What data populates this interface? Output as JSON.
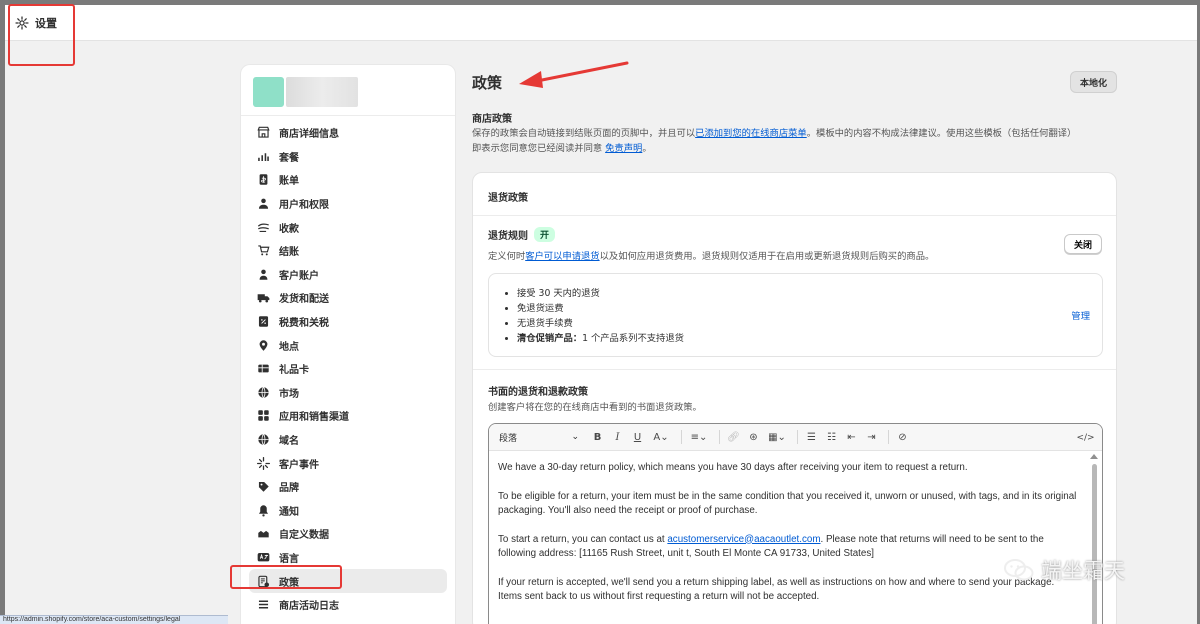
{
  "header": {
    "title": "设置"
  },
  "sidebar": {
    "items": [
      {
        "label": "商店详细信息",
        "icon": "store-icon"
      },
      {
        "label": "套餐",
        "icon": "chart-bars-icon"
      },
      {
        "label": "账单",
        "icon": "bill-icon"
      },
      {
        "label": "用户和权限",
        "icon": "user-icon"
      },
      {
        "label": "收款",
        "icon": "payment-icon"
      },
      {
        "label": "结账",
        "icon": "cart-icon"
      },
      {
        "label": "客户账户",
        "icon": "person-icon"
      },
      {
        "label": "发货和配送",
        "icon": "truck-icon"
      },
      {
        "label": "税费和关税",
        "icon": "tax-icon"
      },
      {
        "label": "地点",
        "icon": "location-icon"
      },
      {
        "label": "礼品卡",
        "icon": "gift-card-icon"
      },
      {
        "label": "市场",
        "icon": "globe-icon"
      },
      {
        "label": "应用和销售渠道",
        "icon": "apps-icon"
      },
      {
        "label": "域名",
        "icon": "globe-icon"
      },
      {
        "label": "客户事件",
        "icon": "sparkle-icon"
      },
      {
        "label": "品牌",
        "icon": "brand-icon"
      },
      {
        "label": "通知",
        "icon": "bell-icon"
      },
      {
        "label": "自定义数据",
        "icon": "database-icon"
      },
      {
        "label": "语言",
        "icon": "language-icon"
      },
      {
        "label": "政策",
        "icon": "policy-icon",
        "active": true
      },
      {
        "label": "商店活动日志",
        "icon": "list-icon"
      }
    ]
  },
  "main": {
    "title": "政策",
    "localize_label": "本地化",
    "store_policies": {
      "heading": "商店政策",
      "desc_part1": "保存的政策会自动链接到结账页面的页脚中，并且可以",
      "desc_link1": "已添加到您的在线商店菜单",
      "desc_part2": "。模板中的内容不构成法律建议。使用这些模板（包括任何翻译）",
      "desc_part3": "即表示您同意您已经阅读并同意 ",
      "desc_link2": "免责声明",
      "desc_part4": "。"
    },
    "refund_card": {
      "title": "退货政策",
      "rules_title": "退货规则",
      "rules_badge": "开",
      "close_label": "关闭",
      "rules_desc_part1": "定义何时",
      "rules_desc_link": "客户可以申请退货",
      "rules_desc_part2": "以及如何应用退货费用。退货规则仅适用于在启用或更新退货规则后购买的商品。",
      "rules": [
        "接受 30 天内的退货",
        "免退货运费",
        "无退货手续费"
      ],
      "rule_clearance_label": "清仓促销产品：",
      "rule_clearance_value": "1 个产品系列不支持退货",
      "manage_label": "管理",
      "written_title": "书面的退货和退款政策",
      "written_desc": "创建客户将在您的在线商店中看到的书面退货政策。"
    },
    "editor": {
      "format_label": "段落",
      "p1": "We have a 30-day return policy, which means you have 30 days after receiving your item to request a return.",
      "p2": "To be eligible for a return, your item must be in the same condition that you received it, unworn or unused, with tags, and in its original packaging. You'll also need the receipt or proof of purchase.",
      "p3_part1": "To start a return, you can contact us at ",
      "p3_email": "acustomerservice@aacaoutlet.com",
      "p3_part2": ". Please note that returns will need to be sent to the following address: [11165 Rush Street, unit t, South El Monte CA 91733, United States]",
      "p4_line1": "If your return is accepted, we'll send you a return shipping label, as well as instructions on how and where to send your package.",
      "p4_line2": "Items sent back to us without first requesting a return will not be accepted."
    }
  },
  "watermark": {
    "text": "端坐霜天"
  },
  "statusbar": {
    "url": "https://admin.shopify.com/store/aca-custom/settings/legal"
  },
  "colors": {
    "accent_link": "#005bd3",
    "annotation_red": "#e53935",
    "badge_green_bg": "#cdfee1"
  }
}
